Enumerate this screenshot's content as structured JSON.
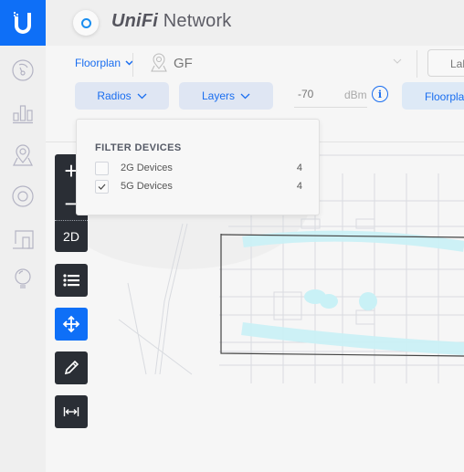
{
  "app": {
    "brand_italic": "UniFi",
    "brand_rest": " Network"
  },
  "sidebar": {
    "items": [
      {
        "icon": "dashboard-gauge-icon",
        "label": "Dashboard"
      },
      {
        "icon": "statistics-bar-chart-icon",
        "label": "Statistics"
      },
      {
        "icon": "map-pin-icon",
        "label": "Map"
      },
      {
        "icon": "devices-circle-icon",
        "label": "Devices"
      },
      {
        "icon": "clients-devices-icon",
        "label": "Clients"
      },
      {
        "icon": "insights-bulb-icon",
        "label": "Insights"
      }
    ]
  },
  "toolbar": {
    "view_dropdown": "Floorplan",
    "location": "GF",
    "labels_button": "Labels",
    "radios_label": "Radios",
    "layers_label": "Layers",
    "signal_value": "-70",
    "signal_unit": "dBm",
    "floorplan_button": "Floorplan"
  },
  "controls": {
    "zoom_in": "+",
    "zoom_out": "−",
    "view_mode": "2D"
  },
  "filter": {
    "title": "FILTER DEVICES",
    "items": [
      {
        "label": "2G Devices",
        "count": "4",
        "checked": false
      },
      {
        "label": "5G Devices",
        "count": "4",
        "checked": true
      }
    ]
  },
  "colors": {
    "accent": "#0e6ff7",
    "coverage": "#bfeef4"
  }
}
